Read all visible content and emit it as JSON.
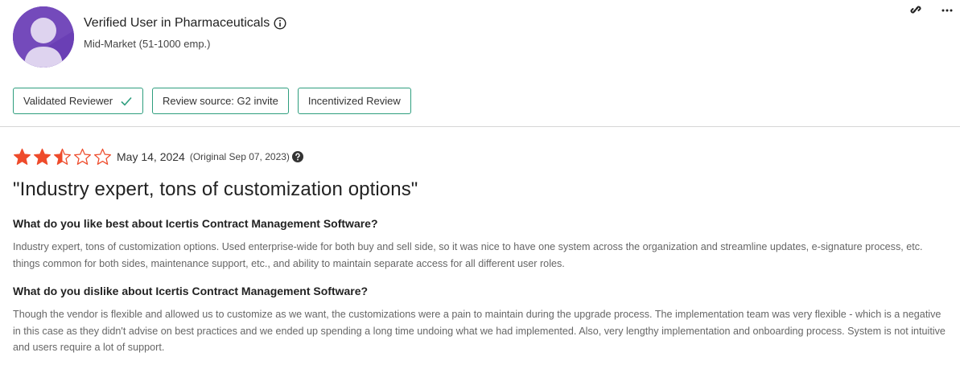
{
  "reviewer": {
    "name": "Verified User in Pharmaceuticals",
    "segment": "Mid-Market (51-1000 emp.)"
  },
  "badges": [
    {
      "label": "Validated Reviewer",
      "icon": "check-icon"
    },
    {
      "label": "Review source: G2 invite"
    },
    {
      "label": "Incentivized Review"
    }
  ],
  "review": {
    "rating": 2.5,
    "max_rating": 5,
    "date": "May 14, 2024",
    "original_date": "(Original Sep 07, 2023)",
    "title": "\"Industry expert, tons of customization options\"",
    "like_question": "What do you like best about Icertis Contract Management Software?",
    "like_answer": "Industry expert, tons of customization options. Used enterprise-wide for both buy and sell side, so it was nice to have one system across the organization and streamline updates, e-signature process, etc. things common for both sides, maintenance support, etc., and ability to maintain separate access for all different user roles.",
    "dislike_question": "What do you dislike about Icertis Contract Management Software?",
    "dislike_answer": "Though the vendor is flexible and allowed us to customize as we want, the customizations were a pain to maintain during the upgrade process. The implementation team was very flexible - which is a negative in this case as they didn't advise on best practices and we ended up spending a long time undoing what we had implemented. Also, very lengthy implementation and onboarding process. System is not intuitive and users require a lot of support."
  },
  "colors": {
    "star": "#ee4b2b",
    "badge_border": "#2e9e7e",
    "avatar": "#6a3fb5"
  },
  "icons": [
    "info-icon",
    "link-icon",
    "more-icon",
    "check-icon",
    "star-icon",
    "help-icon"
  ]
}
